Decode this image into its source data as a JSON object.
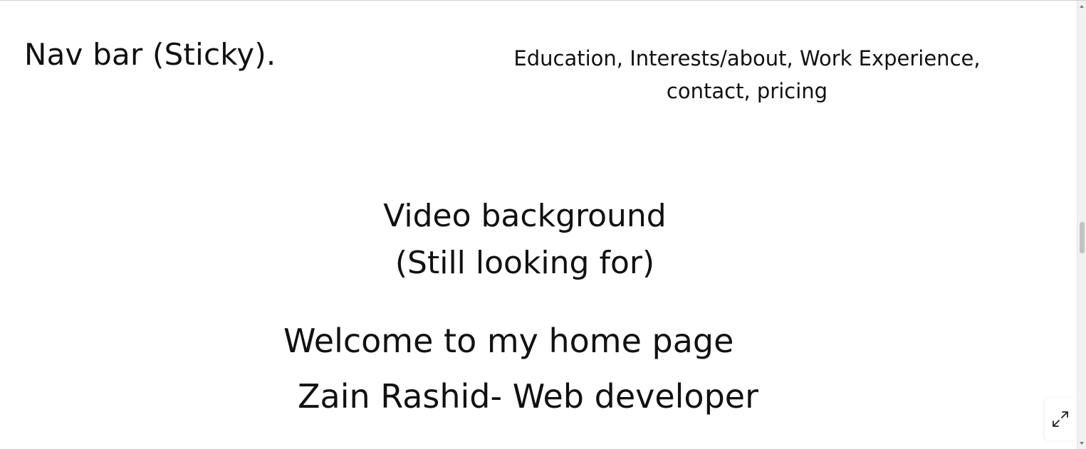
{
  "nav": {
    "title": "Nav bar (Sticky).",
    "links_line1": "Education, Interests/about, Work Experience,",
    "links_line2": "contact, pricing"
  },
  "hero": {
    "video_line1": "Video background",
    "video_line2": "(Still looking for)",
    "welcome": "Welcome to my home page",
    "name": "Zain Rashid- Web developer"
  },
  "controls": {
    "fullscreen_icon": "expand-icon"
  },
  "colors": {
    "text": "#111111",
    "background": "#ffffff",
    "scroll_thumb": "#c1c1c1"
  },
  "scroll": {
    "thumb_position_fraction": 0.5
  }
}
